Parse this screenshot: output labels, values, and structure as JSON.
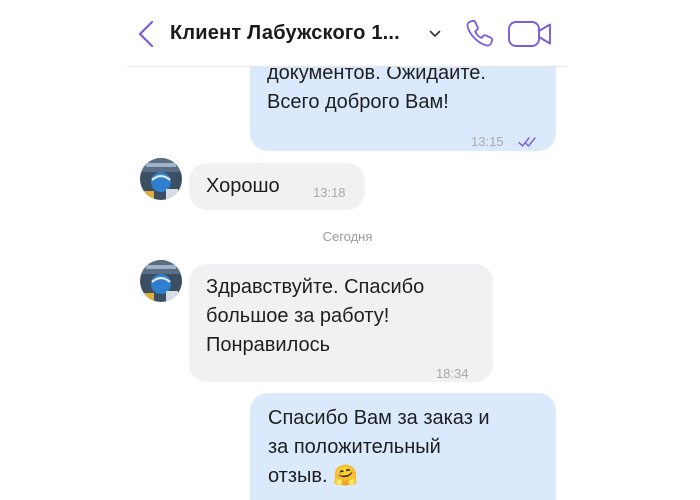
{
  "header": {
    "title": "Клиент Лабужского 1...",
    "icons": {
      "back": "chevron-left-icon",
      "dropdown": "chevron-down-icon",
      "call": "phone-icon",
      "video": "video-camera-icon"
    },
    "accent_color": "#7b5cdb"
  },
  "messages": [
    {
      "direction": "outgoing",
      "text": "документов. Ожидайте.\nВсего доброго Вам!",
      "time": "13:15",
      "status": "read"
    },
    {
      "direction": "incoming",
      "text": "Хорошо",
      "time": "13:18"
    },
    {
      "direction": "incoming",
      "text": "Здравствуйте. Спасибо\nбольшое за работу!\nПонравилось",
      "time": "18:34"
    },
    {
      "direction": "outgoing",
      "text": "Спасибо Вам за заказ и\nза положительный\nотзыв. 🤗"
    }
  ],
  "date_separator": "Сегодня",
  "colors": {
    "outgoing_bubble": "#dbe9fd",
    "incoming_bubble": "#f1f1f3"
  }
}
